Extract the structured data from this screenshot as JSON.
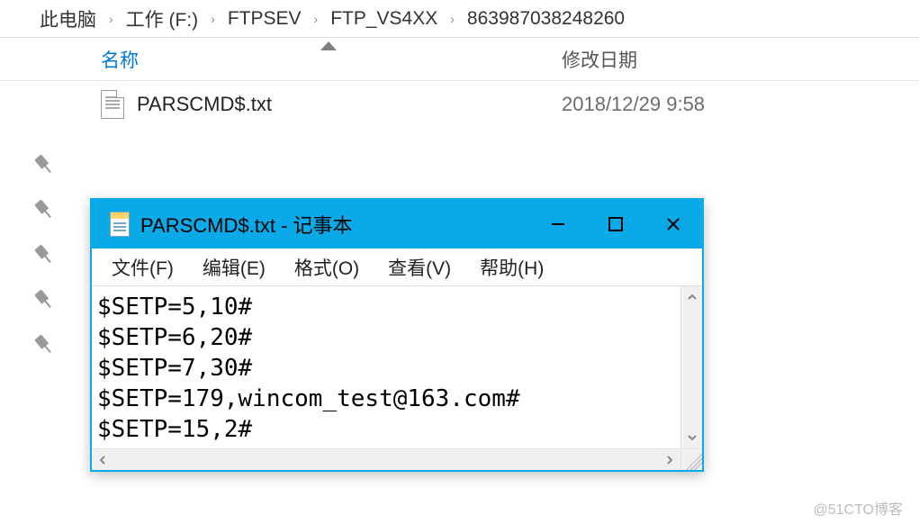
{
  "breadcrumb": {
    "items": [
      "此电脑",
      "工作 (F:)",
      "FTPSEV",
      "FTP_VS4XX",
      "863987038248260"
    ]
  },
  "columns": {
    "name": "名称",
    "modified": "修改日期"
  },
  "files": [
    {
      "name": "PARSCMD$.txt",
      "modified": "2018/12/29 9:58"
    }
  ],
  "notepad": {
    "title": "PARSCMD$.txt - 记事本",
    "menu": {
      "file": "文件(F)",
      "edit": "编辑(E)",
      "format": "格式(O)",
      "view": "查看(V)",
      "help": "帮助(H)"
    },
    "content": "$SETP=5,10#\n$SETP=6,20#\n$SETP=7,30#\n$SETP=179,wincom_test@163.com#\n$SETP=15,2#"
  },
  "watermark": "@51CTO博客"
}
